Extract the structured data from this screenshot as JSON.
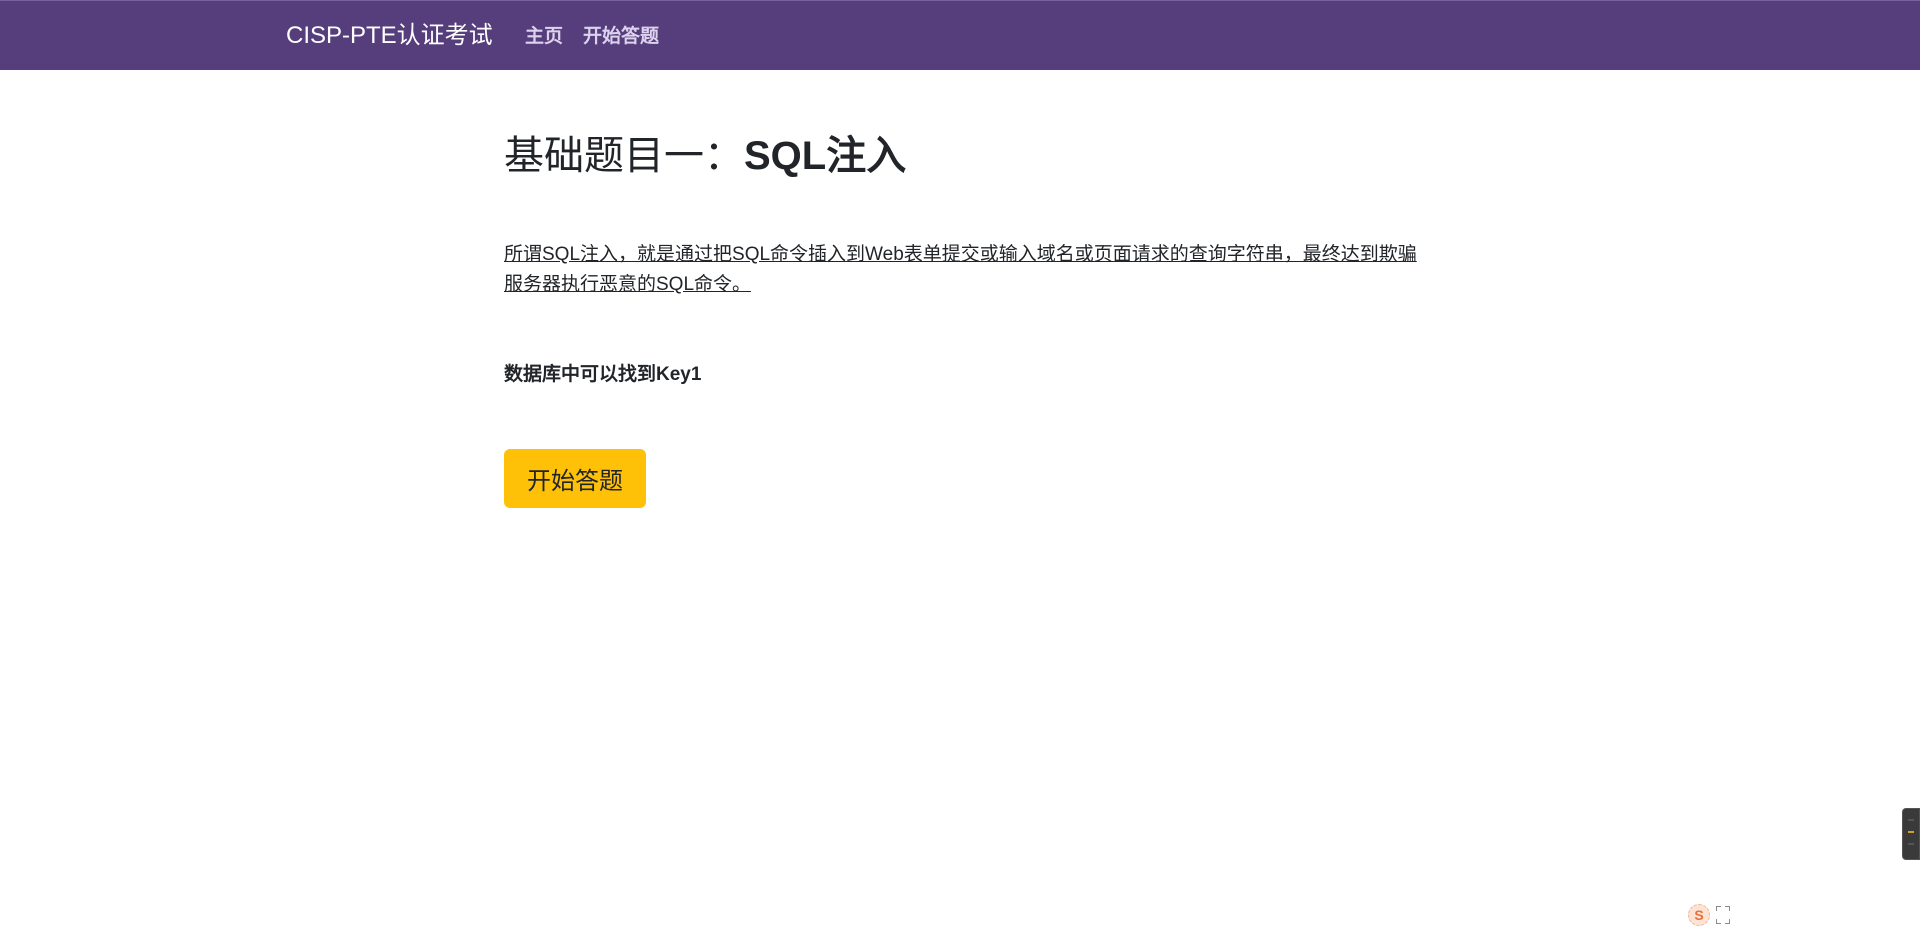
{
  "navbar": {
    "brand": "CISP-PTE认证考试",
    "links": [
      {
        "label": "主页"
      },
      {
        "label": "开始答题"
      }
    ],
    "background_color": "#563d7c"
  },
  "main": {
    "title_prefix": "基础题目一：",
    "title_strong": "SQL注入",
    "description": "所谓SQL注入，就是通过把SQL命令插入到Web表单提交或输入域名或页面请求的查询字符串，最终达到欺骗服务器执行恶意的SQL命令。",
    "hint": "数据库中可以找到Key1",
    "start_button_label": "开始答题",
    "button_color": "#ffc107"
  },
  "system_tray": {
    "ime_icon_glyph": "S",
    "icons": [
      "ime-icon",
      "fullscreen-icon"
    ]
  }
}
